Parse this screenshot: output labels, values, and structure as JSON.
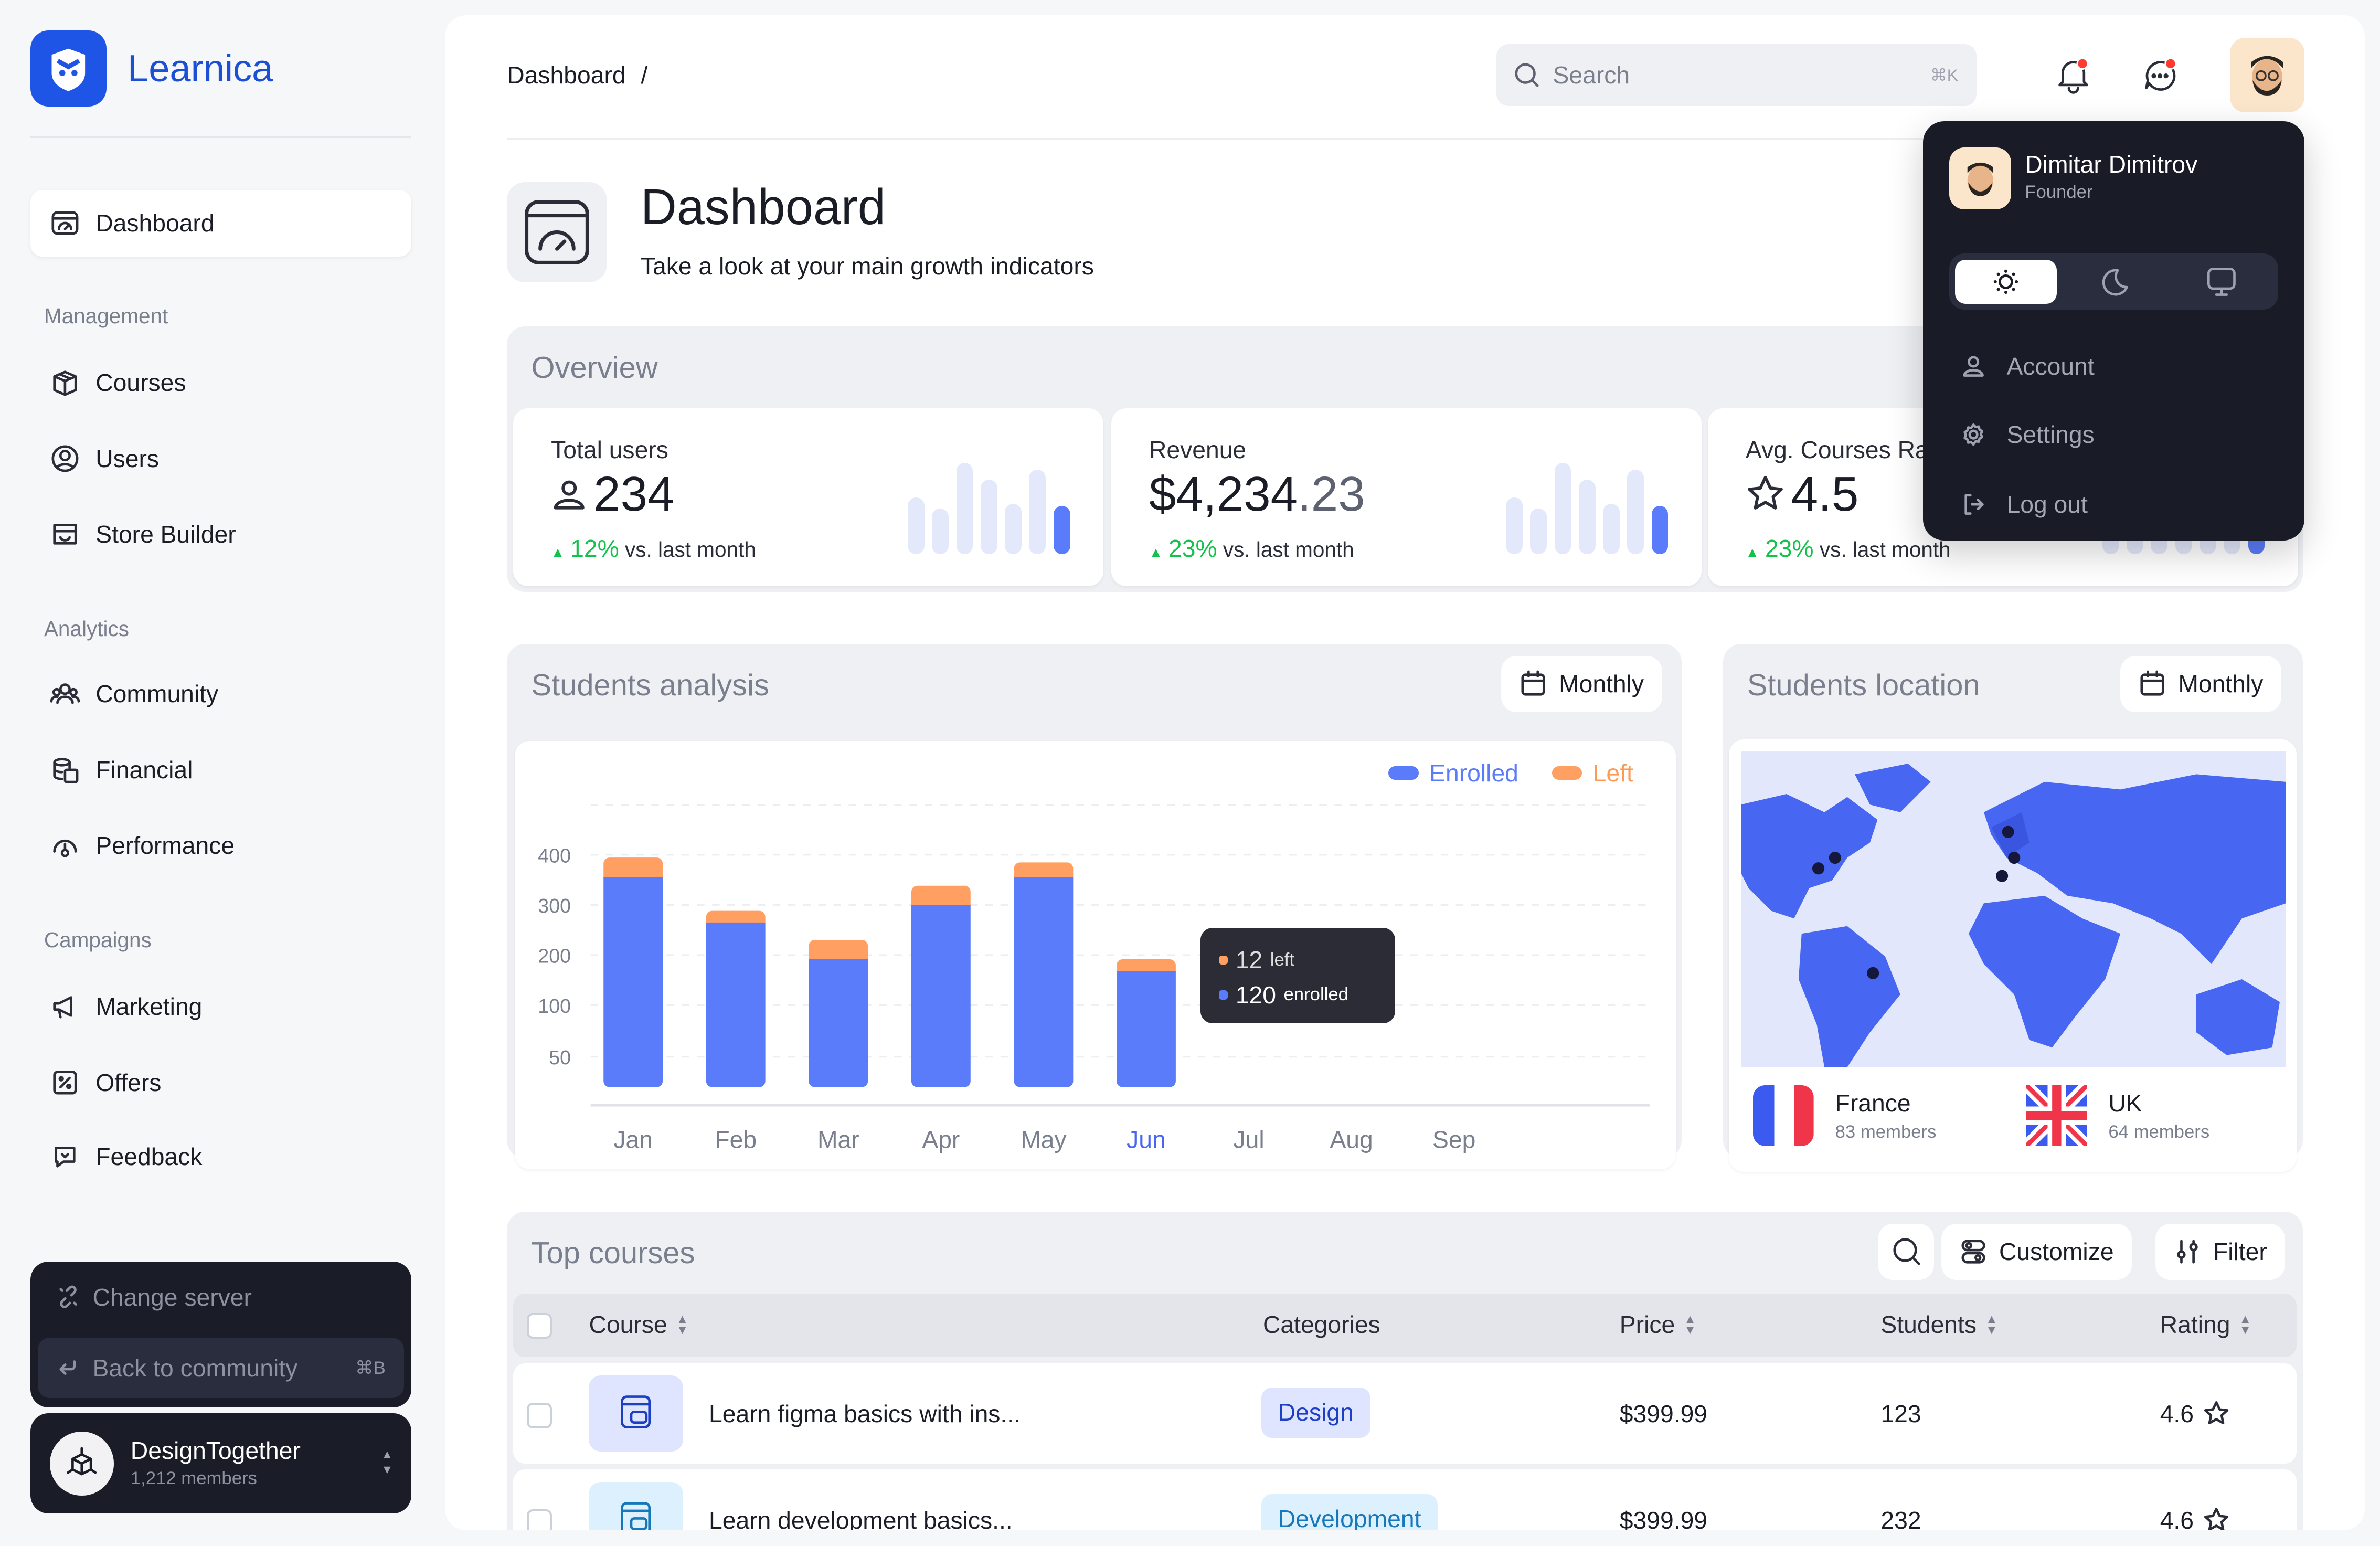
{
  "brand": {
    "name": "Learnica",
    "color": "#1a4fd6"
  },
  "sidebar": {
    "active": {
      "label": "Dashboard",
      "icon": "dashboard-icon"
    },
    "sections": [
      {
        "title": "Management",
        "items": [
          {
            "label": "Courses",
            "icon": "box-icon"
          },
          {
            "label": "Users",
            "icon": "user-circle-icon"
          },
          {
            "label": "Store Builder",
            "icon": "store-icon"
          }
        ]
      },
      {
        "title": "Analytics",
        "items": [
          {
            "label": "Community",
            "icon": "community-icon"
          },
          {
            "label": "Financial",
            "icon": "coins-icon"
          },
          {
            "label": "Performance",
            "icon": "gauge-icon"
          }
        ]
      },
      {
        "title": "Campaigns",
        "items": [
          {
            "label": "Marketing",
            "icon": "megaphone-icon"
          },
          {
            "label": "Offers",
            "icon": "discount-icon"
          },
          {
            "label": "Feedback",
            "icon": "feedback-icon"
          }
        ]
      }
    ],
    "change_server": "Change server",
    "back_to_community": "Back to community",
    "back_shortcut": "⌘B",
    "community": {
      "name": "DesignTogether",
      "members": "1,212 members"
    }
  },
  "header": {
    "breadcrumb": "Dashboard",
    "separator": "/",
    "search_placeholder": "Search",
    "search_shortcut": "⌘K",
    "notification_dot": "#ff3b30"
  },
  "page": {
    "title": "Dashboard",
    "subtitle": "Take a look at your main growth indicators"
  },
  "overview": {
    "title": "Overview",
    "cards": [
      {
        "label": "Total users",
        "value": "234",
        "icon": "user-icon",
        "delta": "12%",
        "delta_text": "vs. last month",
        "sparkline": [
          0.62,
          0.5,
          1,
          0.82,
          0.55,
          0.93,
          0.53
        ]
      },
      {
        "label": "Revenue",
        "value": "$4,234",
        "value_decimals": ".23",
        "delta": "23%",
        "delta_text": "vs. last month",
        "sparkline": [
          0.62,
          0.5,
          1,
          0.82,
          0.55,
          0.93,
          0.53
        ]
      },
      {
        "label": "Avg. Courses Rating",
        "value": "4.5",
        "icon": "star-icon",
        "delta": "23%",
        "delta_text": "vs. last month",
        "sparkline": [
          0.62,
          0.5,
          1,
          0.82,
          0.55,
          0.93,
          0.53
        ]
      }
    ]
  },
  "students_analysis": {
    "title": "Students analysis",
    "period": "Monthly"
  },
  "chart_data": {
    "type": "bar",
    "stacked": true,
    "categories": [
      "Jan",
      "Feb",
      "Mar",
      "Apr",
      "May",
      "Jun",
      "Jul",
      "Aug",
      "Sep"
    ],
    "series": [
      {
        "name": "Enrolled",
        "color": "#5b7cfa",
        "values": [
          217,
          170,
          132,
          188,
          217,
          120,
          null,
          null,
          null
        ]
      },
      {
        "name": "Left",
        "color": "#ffa062",
        "values": [
          20,
          12,
          20,
          20,
          15,
          12,
          null,
          null,
          null
        ]
      }
    ],
    "y_ticks": [
      "400",
      "300",
      "200",
      "100",
      "50"
    ],
    "highlight": "Jun",
    "tooltip": {
      "left_value": "12",
      "left_label": "left",
      "enrolled_value": "120",
      "enrolled_label": "enrolled"
    },
    "legend": "top-right",
    "grid": true
  },
  "students_location": {
    "title": "Students location",
    "period": "Monthly",
    "countries": [
      {
        "name": "France",
        "members": "83 members",
        "flag": "france-flag"
      },
      {
        "name": "UK",
        "members": "64 members",
        "flag": "uk-flag"
      }
    ]
  },
  "top_courses": {
    "title": "Top courses",
    "customize": "Customize",
    "filter": "Filter",
    "columns": [
      "Course",
      "Categories",
      "Price",
      "Students",
      "Rating"
    ],
    "rows": [
      {
        "course": "Learn figma basics with ins...",
        "category": "Design",
        "price": "$399.99",
        "students": "123",
        "rating": "4.6",
        "color": "#dfe5ff",
        "text": "#1d3fc4"
      },
      {
        "course": "Learn development basics...",
        "category": "Development",
        "price": "$399.99",
        "students": "232",
        "rating": "4.6",
        "color": "#dcf1fd",
        "text": "#1777b8"
      }
    ]
  },
  "user_menu": {
    "name": "Dimitar Dimitrov",
    "role": "Founder",
    "theme_options": [
      "light",
      "dark",
      "system"
    ],
    "theme_selected": "light",
    "items": [
      {
        "label": "Account",
        "icon": "user-icon"
      },
      {
        "label": "Settings",
        "icon": "gear-icon"
      },
      {
        "label": "Log out",
        "icon": "logout-icon"
      }
    ]
  }
}
